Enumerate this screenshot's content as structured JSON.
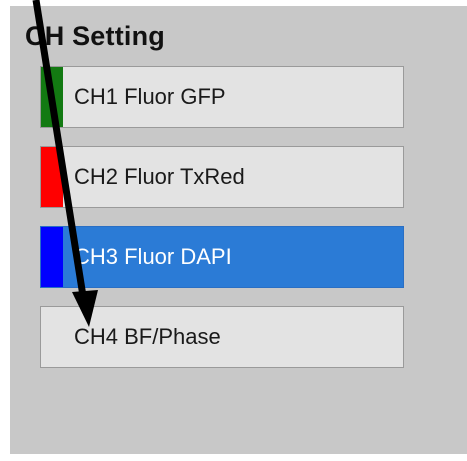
{
  "panel": {
    "title": "CH Setting"
  },
  "channels": [
    {
      "label": "CH1 Fluor GFP",
      "color": "#137a12",
      "selected": false
    },
    {
      "label": "CH2 Fluor TxRed",
      "color": "#ff0000",
      "selected": false
    },
    {
      "label": "CH3 Fluor DAPI",
      "color": "#0000ff",
      "selected": true
    },
    {
      "label": "CH4 BF/Phase",
      "color": null,
      "selected": false
    }
  ],
  "colors": {
    "panel_bg": "#c8c8c8",
    "button_bg": "#e3e3e3",
    "selected_bg": "#2b7bd6"
  },
  "icons": {
    "annotation": "pointer-arrow-icon"
  }
}
